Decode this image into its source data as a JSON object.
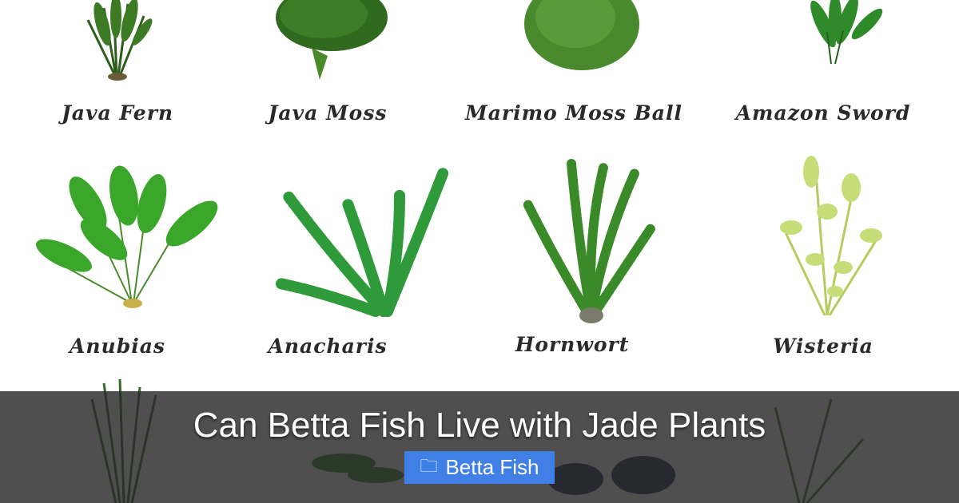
{
  "article": {
    "title": "Can Betta Fish Live with Jade Plants",
    "category_label": "Betta Fish",
    "category_icon": "folder-icon"
  },
  "plants": [
    {
      "name": "Java Fern"
    },
    {
      "name": "Java Moss"
    },
    {
      "name": "Marimo Moss Ball"
    },
    {
      "name": "Amazon Sword"
    },
    {
      "name": "Anubias"
    },
    {
      "name": "Anacharis"
    },
    {
      "name": "Hornwort"
    },
    {
      "name": "Wisteria"
    }
  ],
  "colors": {
    "overlay": "#282828",
    "badge": "#3f7fe6",
    "label_text": "#2a2a2a",
    "plant_dark_green": "#2e6a1e",
    "plant_green": "#3fa02a",
    "plant_light_green": "#b8d86a"
  }
}
